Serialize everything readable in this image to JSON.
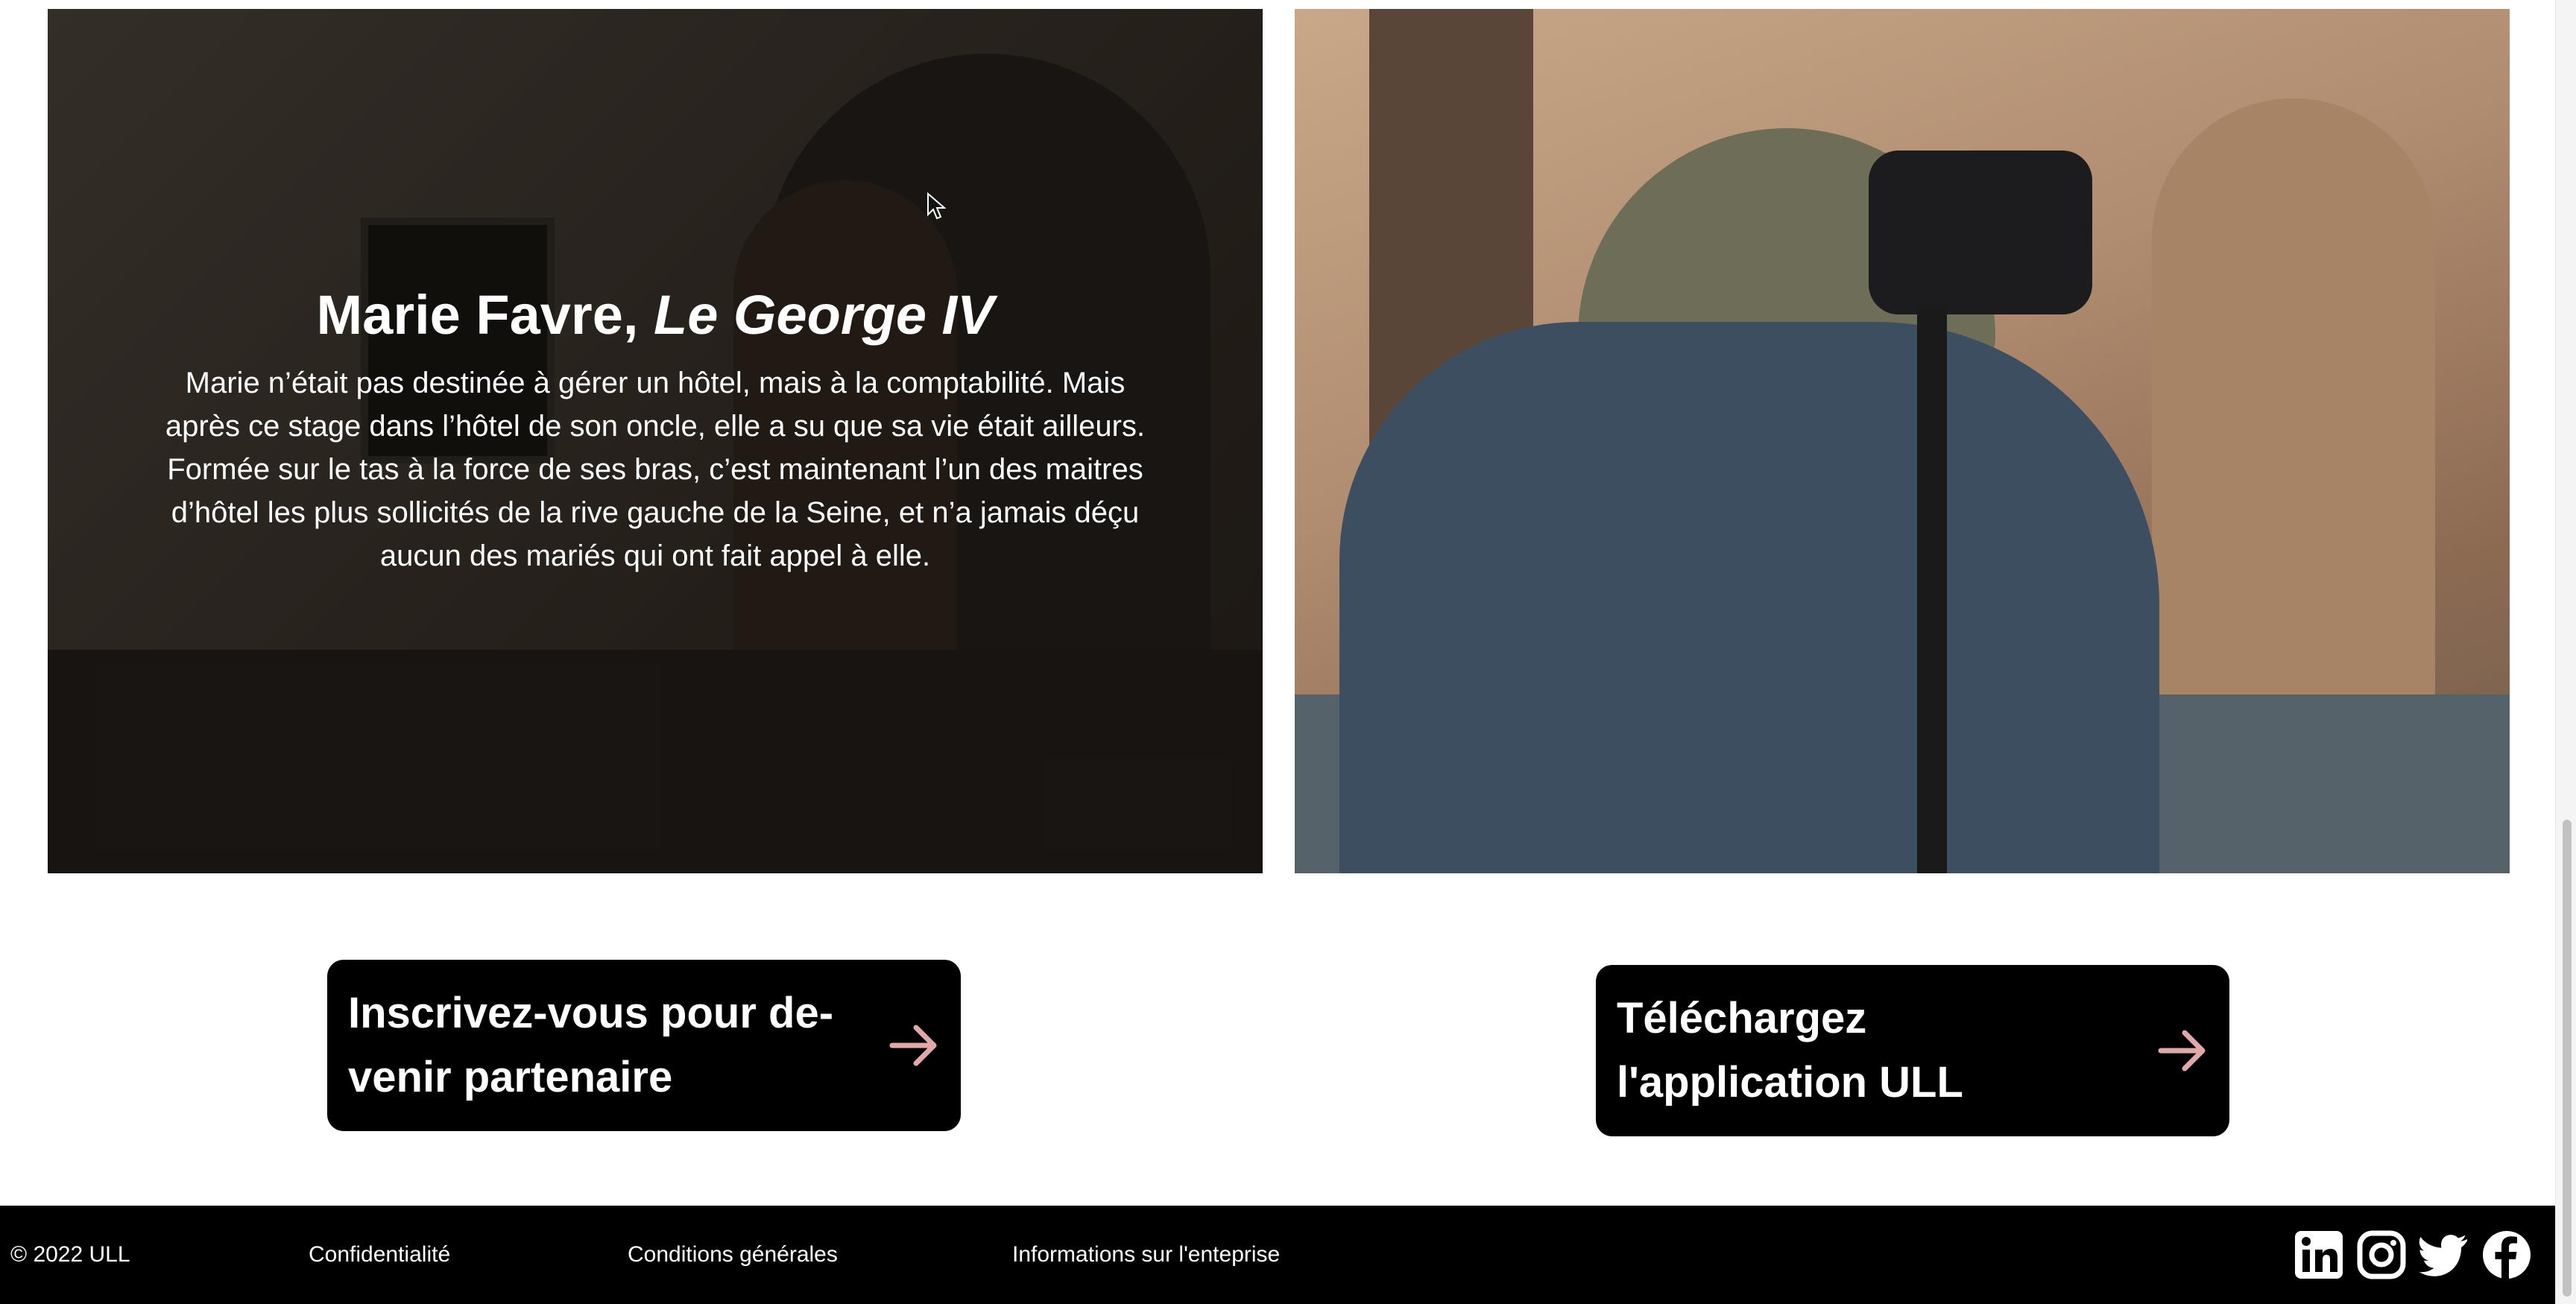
{
  "testimonial": {
    "name": "Marie Favre,",
    "venue": "Le George IV",
    "text": "Marie n’était pas destinée à gérer un hôtel, mais à la comptabilité. Mais après ce stage dans l’hôtel de son oncle, elle a su que sa vie était ailleurs. Formée sur le tas à la force de ses bras, c’est maintenant l’un des maitres d’hôtel les plus sollicités de la rive gauche de la Seine, et n’a jamais déçu aucun des mariés qui ont fait appel à elle."
  },
  "cta": {
    "partner_label": "Inscrivez-vous pour de­venir partenaire",
    "app_label": "Téléchargez l'application ULL",
    "arrow_color": "#e0a8a8"
  },
  "footer": {
    "copyright": "© 2022 ULL",
    "links": [
      "Confidentialité",
      "Conditions générales",
      "Informations sur l'enteprise"
    ],
    "social_icons": [
      "linkedin-icon",
      "instagram-icon",
      "twitter-icon",
      "facebook-icon"
    ]
  }
}
